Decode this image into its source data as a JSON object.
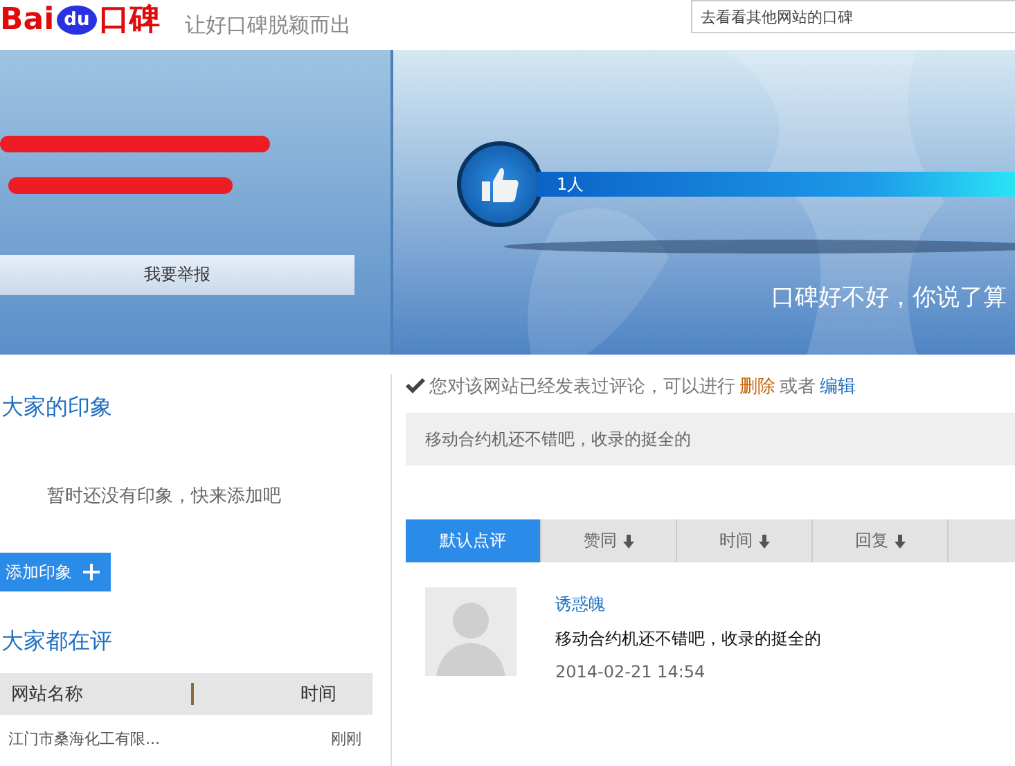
{
  "header": {
    "logo": {
      "part_1": "Bai",
      "part_2": "du",
      "part_3": "口碑"
    },
    "slogan": "让好口碑脱颖而出",
    "search": {
      "placeholder": "去看看其他网站的口碑"
    }
  },
  "banner": {
    "report_button": "我要举报",
    "like_count": "1人",
    "tagline": "口碑好不好，你说了算"
  },
  "impressions": {
    "title": "大家的印象",
    "empty_text": "暂时还没有印象，快来添加吧",
    "add_button": "添加印象"
  },
  "trending": {
    "title": "大家都在评",
    "columns": [
      "网站名称",
      "时间"
    ],
    "rows": [
      {
        "name": "江门市桑海化工有限...",
        "time": "刚刚"
      }
    ]
  },
  "notice": {
    "text": "您对该网站已经发表过评论，可以进行",
    "delete_link": "删除",
    "or": "或者",
    "edit_link": "编辑"
  },
  "my_comment": "移动合约机还不错吧，收录的挺全的",
  "sort_tabs": [
    {
      "label": "默认点评",
      "selected": true,
      "arrow": false
    },
    {
      "label": "赞同",
      "selected": false,
      "arrow": true
    },
    {
      "label": "时间",
      "selected": false,
      "arrow": true
    },
    {
      "label": "回复",
      "selected": false,
      "arrow": true
    }
  ],
  "reviews": [
    {
      "user": "诱惑魄",
      "text": "移动合约机还不错吧，收录的挺全的",
      "time": "2014-02-21 14:54"
    }
  ]
}
